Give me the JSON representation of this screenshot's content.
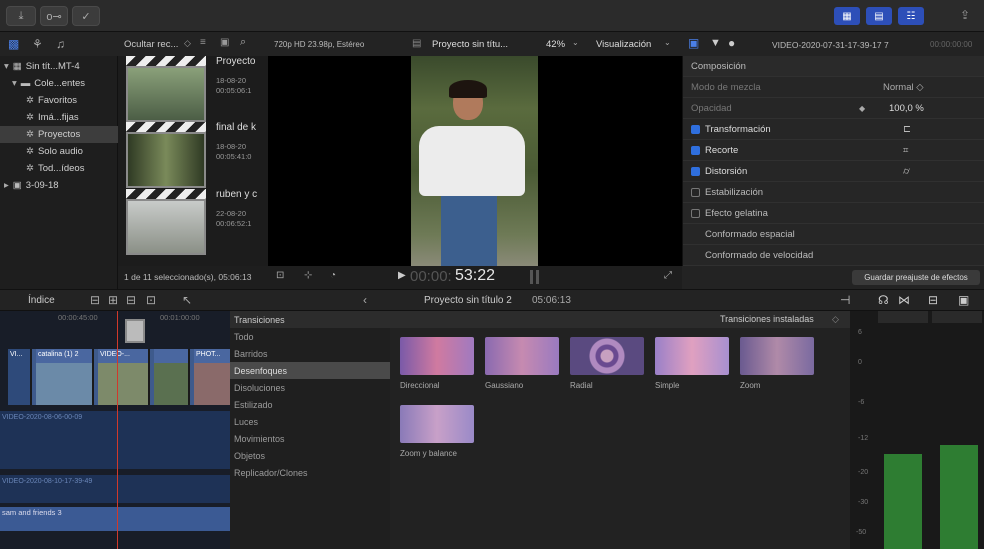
{
  "toolbar": {
    "import_label": "⤓",
    "keywords_label": "o⊸",
    "check_label": "✓"
  },
  "browser": {
    "filter_label": "Ocultar rec...",
    "format_label": "720p HD 23.98p, Estéreo",
    "project_title": "Proyecto sin títu...",
    "zoom": "42%",
    "view_menu": "Visualización",
    "clip_name": "VIDEO-2020-07-31-17-39-17 7",
    "timecode_short": "00:00:00:00"
  },
  "library": {
    "items": [
      {
        "label": "Sin tít...MT-4"
      },
      {
        "label": "Cole...entes"
      },
      {
        "label": "Favoritos"
      },
      {
        "label": "Imá...fijas"
      },
      {
        "label": "Proyectos"
      },
      {
        "label": "Solo audio"
      },
      {
        "label": "Tod...ídeos"
      },
      {
        "label": "3-09-18"
      }
    ]
  },
  "clips": [
    {
      "name": "Proyecto",
      "date": "18-08-20",
      "dur": "00:05:06:1"
    },
    {
      "name": "final de k",
      "date": "18-08-20",
      "dur": "00:05:41:0"
    },
    {
      "name": "ruben y c",
      "date": "22-08-20",
      "dur": "00:06:52:1"
    }
  ],
  "viewer": {
    "selection_status": "1 de 11 seleccionado(s), 05:06:13",
    "timecode": "53:22",
    "timecode_prefix": "00:00:"
  },
  "inspector": {
    "rows": [
      {
        "label": "Composición",
        "value": ""
      },
      {
        "label": "Modo de mezcla",
        "value": "Normal ◇"
      },
      {
        "label": "Opacidad",
        "value": "100,0 %"
      },
      {
        "label": "Transformación",
        "value": ""
      },
      {
        "label": "Recorte",
        "value": ""
      },
      {
        "label": "Distorsión",
        "value": ""
      },
      {
        "label": "Estabilización",
        "value": ""
      },
      {
        "label": "Efecto gelatina",
        "value": ""
      },
      {
        "label": "Conformado espacial",
        "value": ""
      },
      {
        "label": "Conformado de velocidad",
        "value": ""
      }
    ],
    "save_preset": "Guardar preajuste de efectos"
  },
  "timeline_bar": {
    "index_label": "Índice",
    "project_name": "Proyecto sin título 2",
    "duration": "05:06:13"
  },
  "timeline": {
    "ruler_left": "00:00:45:00",
    "ruler_right": "00:01:00:00",
    "clip1": "VI...",
    "clip2": "catalina (1) 2",
    "clip3": "VIDEO-...",
    "clip4": "PHOT...",
    "audio1": "VIDEO-2020-08-06-00-09",
    "audio2": "VIDEO-2020-08-10-17-39-49",
    "audio3": "sam and friends 3"
  },
  "transitions": {
    "header": "Transiciones",
    "installed": "Transiciones instaladas",
    "categories": [
      {
        "label": "Todo"
      },
      {
        "label": "Barridos"
      },
      {
        "label": "Desenfoques"
      },
      {
        "label": "Disoluciones"
      },
      {
        "label": "Estilizado"
      },
      {
        "label": "Luces"
      },
      {
        "label": "Movimientos"
      },
      {
        "label": "Objetos"
      },
      {
        "label": "Replicador/Clones"
      }
    ],
    "items": [
      {
        "label": "Direccional"
      },
      {
        "label": "Gaussiano"
      },
      {
        "label": "Radial"
      },
      {
        "label": "Simple"
      },
      {
        "label": "Zoom"
      },
      {
        "label": "Zoom y balance"
      }
    ]
  },
  "meters": {
    "ticks": [
      "6",
      "0",
      "-6",
      "-12",
      "-20",
      "-30",
      "-50"
    ],
    "level_left": 0.42,
    "level_right": 0.46
  },
  "colors": {
    "accent": "#2f6fde",
    "meter_green": "#2e7d32",
    "playhead": "#d0392b"
  }
}
